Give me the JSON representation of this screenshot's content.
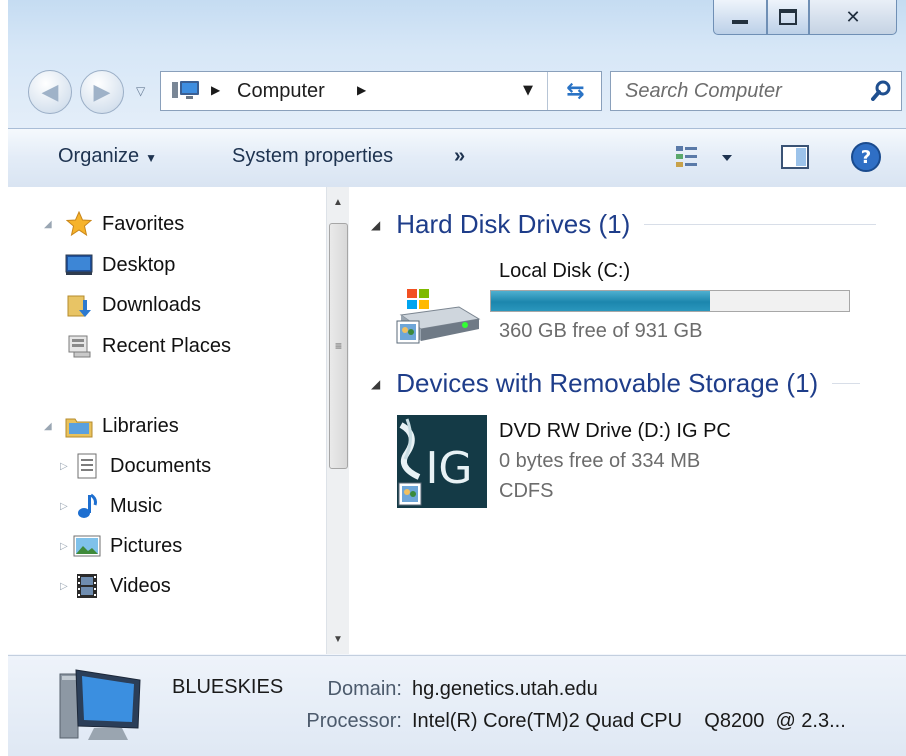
{
  "window": {
    "caption_buttons": {
      "minimize": "minimize-icon",
      "maximize": "maximize-icon",
      "close": "✕"
    }
  },
  "address_bar": {
    "crumbs": [
      "Computer"
    ],
    "search_placeholder": "Search Computer"
  },
  "toolbar": {
    "organize_label": "Organize",
    "system_properties_label": "System properties",
    "overflow_label": "»"
  },
  "navigation": {
    "favorites": {
      "label": "Favorites",
      "items": [
        {
          "label": "Desktop",
          "icon": "desktop-icon"
        },
        {
          "label": "Downloads",
          "icon": "downloads-icon"
        },
        {
          "label": "Recent Places",
          "icon": "recent-places-icon"
        }
      ]
    },
    "libraries": {
      "label": "Libraries",
      "items": [
        {
          "label": "Documents",
          "icon": "documents-icon"
        },
        {
          "label": "Music",
          "icon": "music-icon"
        },
        {
          "label": "Pictures",
          "icon": "pictures-icon"
        },
        {
          "label": "Videos",
          "icon": "videos-icon"
        }
      ]
    }
  },
  "content": {
    "groups": [
      {
        "header": "Hard Disk Drives (1)",
        "items": [
          {
            "name": "Local Disk (C:)",
            "free_text": "360 GB free of 931 GB",
            "used_fraction": 0.613
          }
        ]
      },
      {
        "header": "Devices with Removable Storage (1)",
        "items": [
          {
            "name": "DVD RW Drive (D:) IG PC",
            "free_text": "0 bytes free of 334 MB",
            "filesystem": "CDFS",
            "logo_text": "IG"
          }
        ]
      }
    ]
  },
  "details": {
    "computer_name": "BLUESKIES",
    "domain_label": "Domain:",
    "domain_value": "hg.genetics.utah.edu",
    "processor_label": "Processor:",
    "processor_value": "Intel(R) Core(TM)2 Quad CPU    Q8200  @ 2.3..."
  },
  "colors": {
    "group_header": "#1e3d8a",
    "progress_fill": "#1c86ad"
  }
}
